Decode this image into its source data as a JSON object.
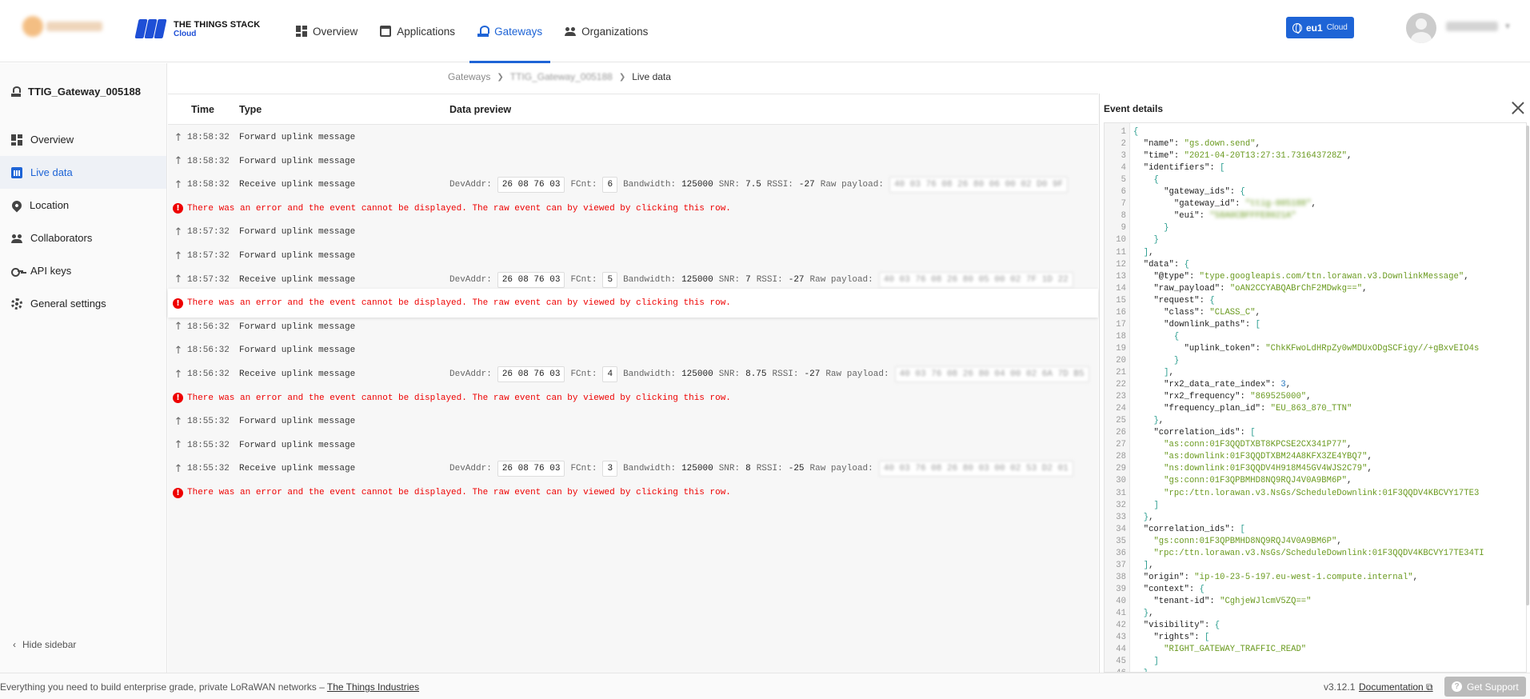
{
  "header": {
    "brand_title": "THE THINGS STACK",
    "brand_subtitle": "Cloud",
    "nav": [
      {
        "label": "Overview",
        "icon": "grid-icon"
      },
      {
        "label": "Applications",
        "icon": "application-icon"
      },
      {
        "label": "Gateways",
        "icon": "gateway-icon",
        "active": true
      },
      {
        "label": "Organizations",
        "icon": "people-icon"
      }
    ],
    "region": {
      "name": "eu1",
      "suffix": "Cloud"
    },
    "accent": "#1e64d6"
  },
  "sidebar": {
    "gateway_name": "TTIG_Gateway_005188",
    "items": [
      {
        "label": "Overview",
        "icon": "grid-icon"
      },
      {
        "label": "Live data",
        "icon": "chart-icon",
        "active": true
      },
      {
        "label": "Location",
        "icon": "pin-icon"
      },
      {
        "label": "Collaborators",
        "icon": "people-icon"
      },
      {
        "label": "API keys",
        "icon": "key-icon"
      },
      {
        "label": "General settings",
        "icon": "gear-icon"
      }
    ],
    "hide_label": "Hide sidebar"
  },
  "breadcrumb": {
    "items": [
      "Gateways",
      "TTIG_Gateway_005188",
      "Live data"
    ]
  },
  "table": {
    "columns": {
      "time": "Time",
      "type": "Type",
      "preview": "Data preview"
    },
    "labels": {
      "devaddr": "DevAddr:",
      "fcnt": "FCnt:",
      "bandwidth": "Bandwidth:",
      "snr": "SNR:",
      "rssi": "RSSI:",
      "raw": "Raw payload:"
    },
    "rows": [
      {
        "kind": "event",
        "time": "18:58:32",
        "type": "Forward uplink message"
      },
      {
        "kind": "event",
        "time": "18:58:32",
        "type": "Forward uplink message"
      },
      {
        "kind": "receive",
        "time": "18:58:32",
        "type": "Receive uplink message",
        "devaddr": "26 08 76 03",
        "fcnt": "6",
        "bandwidth": "125000",
        "snr": "7.5",
        "rssi": "-27",
        "raw": "40 03 76 08 26 80 06 00 02 D0 9F"
      },
      {
        "kind": "error",
        "message": "There was an error and the event cannot be displayed. The raw event can by viewed by clicking this row."
      },
      {
        "kind": "event",
        "time": "18:57:32",
        "type": "Forward uplink message"
      },
      {
        "kind": "event",
        "time": "18:57:32",
        "type": "Forward uplink message"
      },
      {
        "kind": "receive",
        "time": "18:57:32",
        "type": "Receive uplink message",
        "devaddr": "26 08 76 03",
        "fcnt": "5",
        "bandwidth": "125000",
        "snr": "7",
        "rssi": "-27",
        "raw": "40 03 76 08 26 80 05 00 02 7F 1D 22"
      },
      {
        "kind": "error",
        "message": "There was an error and the event cannot be displayed. The raw event can by viewed by clicking this row.",
        "highlight": true
      },
      {
        "kind": "event",
        "time": "18:56:32",
        "type": "Forward uplink message"
      },
      {
        "kind": "event",
        "time": "18:56:32",
        "type": "Forward uplink message"
      },
      {
        "kind": "receive",
        "time": "18:56:32",
        "type": "Receive uplink message",
        "devaddr": "26 08 76 03",
        "fcnt": "4",
        "bandwidth": "125000",
        "snr": "8.75",
        "rssi": "-27",
        "raw": "40 03 76 08 26 80 04 00 02 6A 7D B5"
      },
      {
        "kind": "error",
        "message": "There was an error and the event cannot be displayed. The raw event can by viewed by clicking this row."
      },
      {
        "kind": "event",
        "time": "18:55:32",
        "type": "Forward uplink message"
      },
      {
        "kind": "event",
        "time": "18:55:32",
        "type": "Forward uplink message"
      },
      {
        "kind": "receive",
        "time": "18:55:32",
        "type": "Receive uplink message",
        "devaddr": "26 08 76 03",
        "fcnt": "3",
        "bandwidth": "125000",
        "snr": "8",
        "rssi": "-25",
        "raw": "40 03 76 08 26 80 03 00 02 53 D2 01"
      },
      {
        "kind": "error",
        "message": "There was an error and the event cannot be displayed. The raw event can by viewed by clicking this row."
      }
    ]
  },
  "details": {
    "title": "Event details",
    "lines": [
      "{",
      "  \"name\": \"gs.down.send\",",
      "  \"time\": \"2021-04-20T13:27:31.731643728Z\",",
      "  \"identifiers\": [",
      "    {",
      "      \"gateway_ids\": {",
      "        \"gateway_id\": \"ttig-005188\",",
      "        \"eui\": \"58A0CBFFFE8021A\"",
      "      }",
      "    }",
      "  ],",
      "  \"data\": {",
      "    \"@type\": \"type.googleapis.com/ttn.lorawan.v3.DownlinkMessage\",",
      "    \"raw_payload\": \"oAN2CCYABQABrChF2MDwkg==\",",
      "    \"request\": {",
      "      \"class\": \"CLASS_C\",",
      "      \"downlink_paths\": [",
      "        {",
      "          \"uplink_token\": \"ChkKFwoLdHRpZy0wMDUxODgSCFigy//+gBxvEIO4s",
      "        }",
      "      ],",
      "      \"rx2_data_rate_index\": 3,",
      "      \"rx2_frequency\": \"869525000\",",
      "      \"frequency_plan_id\": \"EU_863_870_TTN\"",
      "    },",
      "    \"correlation_ids\": [",
      "      \"as:conn:01F3QQDTXBT8KPCSE2CX341P77\",",
      "      \"as:downlink:01F3QQDTXBM24A8KFX3ZE4YBQ7\",",
      "      \"ns:downlink:01F3QQDV4H918M45GV4WJS2C79\",",
      "      \"gs:conn:01F3QPBMHD8NQ9RQJ4V0A9BM6P\",",
      "      \"rpc:/ttn.lorawan.v3.NsGs/ScheduleDownlink:01F3QQDV4KBCVY17TE3",
      "    ]",
      "  },",
      "  \"correlation_ids\": [",
      "    \"gs:conn:01F3QPBMHD8NQ9RQJ4V0A9BM6P\",",
      "    \"rpc:/ttn.lorawan.v3.NsGs/ScheduleDownlink:01F3QQDV4KBCVY17TE34TI",
      "  ],",
      "  \"origin\": \"ip-10-23-5-197.eu-west-1.compute.internal\",",
      "  \"context\": {",
      "    \"tenant-id\": \"CghjeWJlcmV5ZQ==\"",
      "  },",
      "  \"visibility\": {",
      "    \"rights\": [",
      "      \"RIGHT_GATEWAY_TRAFFIC_READ\"",
      "    ]",
      "  },"
    ]
  },
  "footer": {
    "tagline": "Everything you need to build enterprise grade, private LoRaWAN networks – ",
    "tagline_link": "The Things Industries",
    "version": "v3.12.1",
    "documentation": "Documentation",
    "support": "Get Support"
  }
}
